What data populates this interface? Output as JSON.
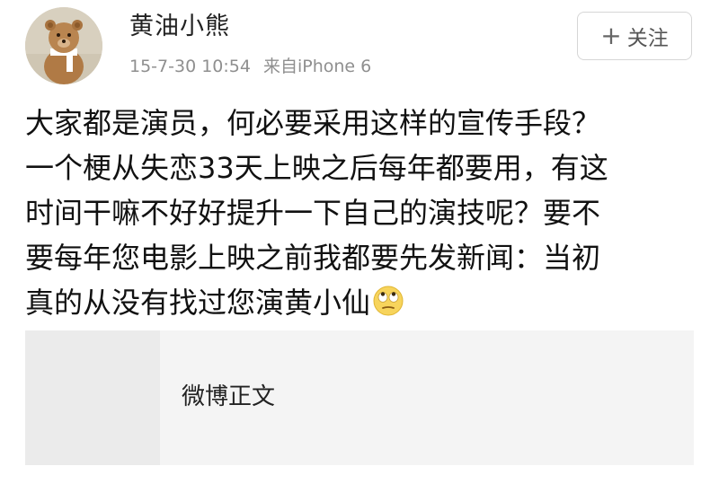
{
  "user": {
    "name": "黄油小熊",
    "avatar_icon": "teddy-bear-avatar-icon"
  },
  "meta": {
    "timestamp": "15-7-30 10:54",
    "source": "来自iPhone 6"
  },
  "follow_button": {
    "icon": "plus-icon",
    "icon_glyph": "+",
    "label": "关注"
  },
  "post": {
    "lines": [
      "大家都是演员，何必要采用这样的宣传手段？",
      "一个梗从失恋33天上映之后每年都要用，有这",
      "时间干嘛不好好提升一下自己的演技呢？要不",
      "要每年您电影上映之前我都要先发新闻：当初",
      "真的从没有找过您演黄小仙"
    ],
    "trailing_emoji": "eye-roll-emoji-icon"
  },
  "card": {
    "title": "微博正文"
  },
  "colors": {
    "text": "#111111",
    "meta": "#8f8f8f",
    "button_border": "#d6d6d6",
    "card_bg": "#f4f4f4",
    "card_thumb_bg": "#ebebeb"
  }
}
